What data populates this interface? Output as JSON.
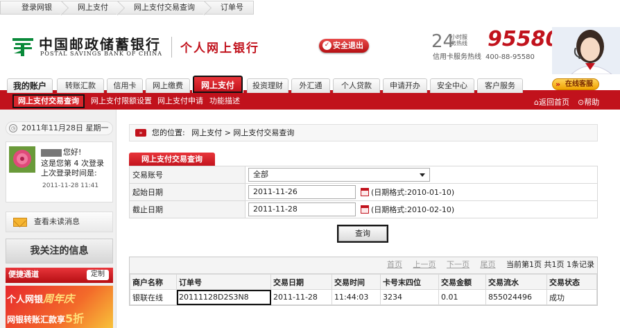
{
  "breadcrumbs": [
    "登录网银",
    "网上支付",
    "网上支付交易查询",
    "订单号"
  ],
  "header": {
    "bank_name_cn": "中国邮政储蓄银行",
    "bank_name_en": "POSTAL SAVINGS BANK OF CHINA",
    "personal_banking": "个人网上银行",
    "exit_button": "安全退出",
    "hotline_24": "24",
    "hotline_small": "小时服务热线",
    "hotline_number": "95580",
    "card_hotline_label": "信用卡服务热线",
    "card_hotline_number": "400-88-95580"
  },
  "nav": {
    "tabs": [
      "我的账户",
      "转账汇款",
      "信用卡",
      "网上缴费",
      "网上支付",
      "投资理财",
      "外汇通",
      "个人贷款",
      "申请开办",
      "安全中心",
      "客户服务"
    ],
    "active": "网上支付",
    "online_service": "在线客服"
  },
  "subnav": {
    "items": [
      "网上支付交易查询",
      "网上支付限额设置",
      "网上支付申请",
      "功能描述"
    ],
    "return_home": "返回首页",
    "help": "帮助"
  },
  "sidebar": {
    "date": "2011年11月28日 星期一",
    "greeting": "您好!",
    "login_count_text": "这是您第 4 次登录",
    "last_login_label": "上次登录时间是:",
    "last_login_time": "2011-11-28 11:41",
    "unread_messages": "查看未读消息",
    "my_follow": "我关注的信息",
    "quick_channel": "便捷通道",
    "customize": "定制",
    "promo_line1_prefix": "个人网银",
    "promo_line1_highlight": "周年庆",
    "promo_line2_prefix": "网银转账汇款享",
    "promo_line2_highlight": "5折"
  },
  "location": {
    "label": "您的位置:",
    "path": "网上支付 > 网上支付交易查询"
  },
  "panel": {
    "title": "网上支付交易查询",
    "account_label": "交易账号",
    "account_value": "全部",
    "start_label": "起始日期",
    "start_value": "2011-11-26",
    "start_format": "(日期格式:2010-01-10)",
    "end_label": "截止日期",
    "end_value": "2011-11-28",
    "end_format": "(日期格式:2010-02-10)",
    "query_button": "查询"
  },
  "results": {
    "pager": [
      "首页",
      "上一页",
      "下一页",
      "尾页"
    ],
    "page_info": "当前第1页 共1页 1条记录",
    "columns": [
      "商户名称",
      "订单号",
      "交易日期",
      "交易时间",
      "卡号末四位",
      "交易金额",
      "交易流水",
      "交易状态"
    ],
    "rows": [
      [
        "银联在线",
        "20111128D2S3N8",
        "2011-11-28",
        "11:44:03",
        "3234",
        "0.01",
        "855024496",
        "成功"
      ]
    ]
  },
  "colors": {
    "brand_red": "#c1121c",
    "brand_green": "#0a8a3a"
  }
}
